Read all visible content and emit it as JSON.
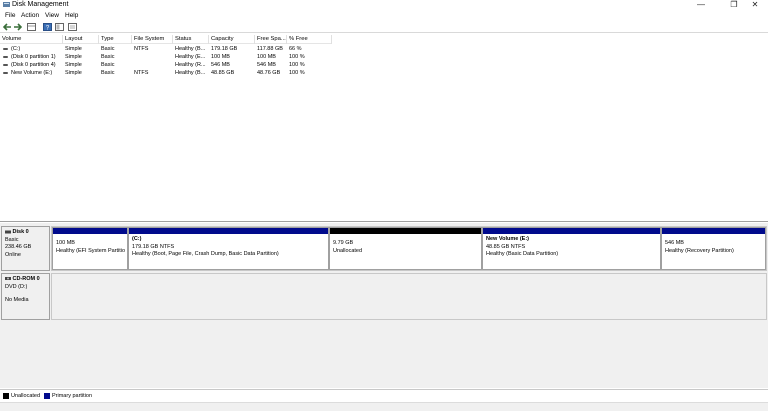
{
  "window": {
    "title": "Disk Management",
    "controls": {
      "minimize": "—",
      "maximize": "❐",
      "close": "✕"
    }
  },
  "menu": [
    "File",
    "Action",
    "View",
    "Help"
  ],
  "toolbar": [
    "back-arrow-icon",
    "forward-arrow-icon",
    "list-view-icon",
    "properties-icon",
    "help-icon",
    "console-icon",
    "refresh-icon"
  ],
  "columns": [
    "Volume",
    "Layout",
    "Type",
    "File System",
    "Status",
    "Capacity",
    "Free Spa...",
    "% Free"
  ],
  "volumes": [
    {
      "name": "(C:)",
      "layout": "Simple",
      "type": "Basic",
      "fs": "NTFS",
      "status": "Healthy (B...",
      "capacity": "179.18 GB",
      "free": "117.88 GB",
      "pct": "66 %"
    },
    {
      "name": "(Disk 0 partition 1)",
      "layout": "Simple",
      "type": "Basic",
      "fs": "",
      "status": "Healthy (E...",
      "capacity": "100 MB",
      "free": "100 MB",
      "pct": "100 %"
    },
    {
      "name": "(Disk 0 partition 4)",
      "layout": "Simple",
      "type": "Basic",
      "fs": "",
      "status": "Healthy (R...",
      "capacity": "546 MB",
      "free": "546 MB",
      "pct": "100 %"
    },
    {
      "name": "New Volume (E:)",
      "layout": "Simple",
      "type": "Basic",
      "fs": "NTFS",
      "status": "Healthy (B...",
      "capacity": "48.85 GB",
      "free": "48.76 GB",
      "pct": "100 %"
    }
  ],
  "disk0": {
    "name": "Disk 0",
    "type": "Basic",
    "size": "238.46 GB",
    "state": "Online",
    "partitions": [
      {
        "name": "",
        "size": "100 MB",
        "status": "Healthy (EFI System Partitio",
        "kind": "primary"
      },
      {
        "name": "(C:)",
        "size": "179.18 GB NTFS",
        "status": "Healthy (Boot, Page File, Crash Dump, Basic Data Partition)",
        "kind": "primary"
      },
      {
        "name": "",
        "size": "9.79 GB",
        "status": "Unallocated",
        "kind": "unallocated"
      },
      {
        "name": "New Volume  (E:)",
        "size": "48.85 GB NTFS",
        "status": "Healthy (Basic Data Partition)",
        "kind": "primary"
      },
      {
        "name": "",
        "size": "546 MB",
        "status": "Healthy (Recovery Partition)",
        "kind": "primary"
      }
    ]
  },
  "cdrom0": {
    "name": "CD-ROM 0",
    "type": "DVD (D:)",
    "state": "No Media"
  },
  "legend": [
    {
      "label": "Unallocated",
      "color": "#000000"
    },
    {
      "label": "Primary partition",
      "color": "#000a8c"
    }
  ]
}
